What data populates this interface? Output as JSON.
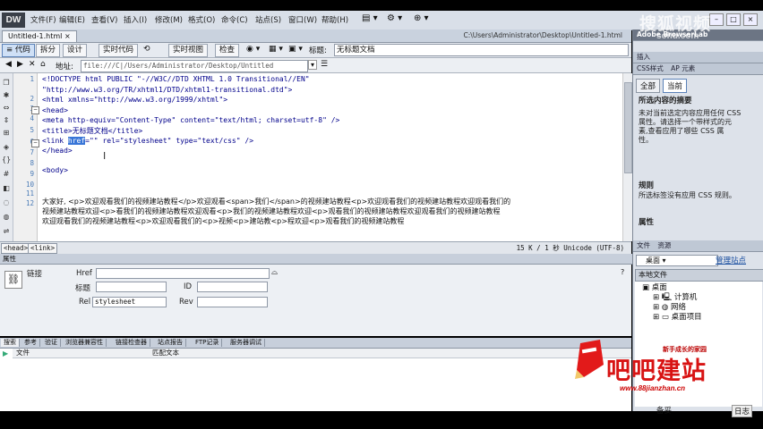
{
  "app": {
    "logo": "DW"
  },
  "menu": [
    "文件(F)",
    "编辑(E)",
    "查看(V)",
    "插入(I)",
    "修改(M)",
    "格式(O)",
    "命令(C)",
    "站点(S)",
    "窗口(W)",
    "帮助(H)"
  ],
  "tab": {
    "name": "Untitled-1.html",
    "path": "C:\\Users\\Administrator\\Desktop\\Untitled-1.html"
  },
  "viewbar": {
    "code": "代码",
    "split": "拆分",
    "design": "设计",
    "live_code": "实时代码",
    "live_view": "实时视图",
    "inspect": "检查",
    "title_label": "标题:",
    "title_value": "无标题文档"
  },
  "address": {
    "label": "地址:",
    "value": "file:///C|/Users/Administrator/Desktop/Untitled"
  },
  "code": {
    "lines": [
      "<!DOCTYPE html PUBLIC \"-//W3C//DTD XHTML 1.0 Transitional//EN\"",
      "\"http://www.w3.org/TR/xhtml1/DTD/xhtml1-transitional.dtd\">",
      "<html xmlns=\"http://www.w3.org/1999/xhtml\">",
      "<head>",
      "<meta http-equiv=\"Content-Type\" content=\"text/html; charset=utf-8\" />",
      "<title>无标题文档</title>",
      "</head>",
      "",
      "<body>"
    ],
    "link_prefix": "<link ",
    "link_selected": "href",
    "link_suffix": "=\"\" rel=\"stylesheet\" type=\"text/css\" />",
    "text_rows": [
      "大家好, <p>欢迎观看我们的视频建站教程</p>欢迎观看<span>我们</span>的视频建站教程<p>欢迎观看我们的视频建站教程欢迎观看我们的",
      "视频建站教程欢迎<p>看我们的视频建站教程欢迎观看<p>我们的视频建站教程欢迎<p>观看我们的视频建站教程欢迎观看我们的视频建站教程",
      "欢迎观看我们的视频建站教程<p>欢迎观看我们的<p>视频<p>建站教<p>程欢迎<p>观看我们的视频建站教程"
    ],
    "line_numbers": [
      "1",
      "2",
      "3",
      "4",
      "5",
      "6",
      "7",
      "8",
      "9",
      "10",
      "11",
      "12"
    ]
  },
  "status": {
    "crumbs": [
      "<head>",
      "<link>"
    ],
    "info": "15 K / 1 秒 Unicode (UTF-8)"
  },
  "properties": {
    "header": "属性",
    "type": "链接",
    "href_label": "Href",
    "title_label": "标题",
    "id_label": "ID",
    "rel_label": "Rel",
    "rel_value": "stylesheet",
    "rev_label": "Rev"
  },
  "results": {
    "tabs": [
      "搜索",
      "参考",
      "验证",
      "浏览器兼容性",
      "链接检查器",
      "站点报告",
      "FTP记录",
      "服务器调试"
    ],
    "col_file": "文件",
    "col_match": "匹配文本"
  },
  "right_panel": {
    "browserlab": "Adobe BrowserLab",
    "insert_tab": "插入",
    "css_tabs": [
      "CSS样式",
      "AP 元素"
    ],
    "css_modes": [
      "全部",
      "当前"
    ],
    "summary_title": "所选内容的摘要",
    "summary_text": [
      "未对当前选定内容应用任何 CSS",
      "属性。请选择一个带样式的元",
      "素,查看应用了哪些 CSS 属",
      "性。"
    ],
    "rules_title": "规则",
    "rules_text": "所选标签没有应用 CSS 规则。",
    "props_title": "属性",
    "files_tabs": [
      "文件",
      "资源"
    ],
    "location": "桌面",
    "manage": "管理站点",
    "local_files": "本地文件",
    "tree": [
      "桌面",
      "计算机",
      "网络",
      "桌面项目"
    ],
    "bottom_label": "备妥",
    "bottom_label2": "日志"
  },
  "overlays": {
    "watermark": "搜狐视频",
    "watermark_sub": "sohu.com",
    "brand": "吧吧建站",
    "slogan": "新手成长的家园",
    "url": "www.88jianzhan.cn"
  }
}
